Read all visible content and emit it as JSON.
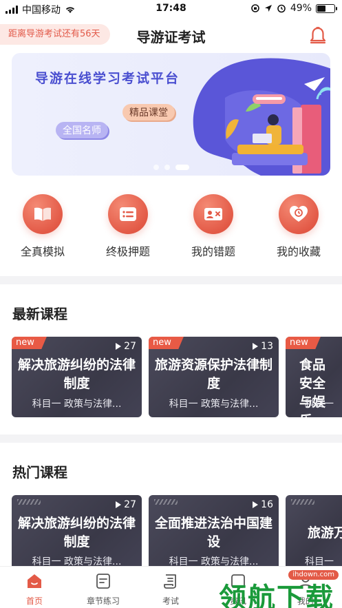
{
  "status_bar": {
    "carrier": "中国移动",
    "time": "17:48",
    "battery": "49%",
    "battery_level": 0.49
  },
  "header": {
    "countdown": "距离导游考试还有56天",
    "title": "导游证考试",
    "bell_icon": "bell-icon"
  },
  "banner": {
    "title": "导游在线学习考试平台",
    "tag_a": "精品课堂",
    "tag_b": "全国名师",
    "active_slide": 3,
    "slides": 3
  },
  "quick_nav": [
    {
      "label": "全真模拟",
      "icon": "book-icon"
    },
    {
      "label": "终极押题",
      "icon": "list-icon"
    },
    {
      "label": "我的错题",
      "icon": "error-card-icon"
    },
    {
      "label": "我的收藏",
      "icon": "heart-clock-icon"
    }
  ],
  "latest": {
    "title": "最新课程",
    "courses": [
      {
        "badge": "new",
        "count": "27",
        "title": "解决旅游纠纷的法律制度",
        "subtitle": "科目一 政策与法律..."
      },
      {
        "badge": "new",
        "count": "13",
        "title": "旅游资源保护法律制度",
        "subtitle": "科目一 政策与法律..."
      },
      {
        "badge": "new",
        "count": "",
        "title": "食品安全与娱乐",
        "subtitle": "科目一"
      }
    ]
  },
  "hot": {
    "title": "热门课程",
    "courses": [
      {
        "count": "27",
        "title": "解决旅游纠纷的法律制度",
        "subtitle": "科目一 政策与法律..."
      },
      {
        "count": "16",
        "title": "全面推进法治中国建设",
        "subtitle": "科目一 政策与法律..."
      },
      {
        "count": "",
        "title": "旅游万",
        "subtitle": "科目一"
      }
    ]
  },
  "tabs": [
    {
      "label": "首页",
      "icon": "home-icon",
      "active": true
    },
    {
      "label": "章节练习",
      "icon": "chapter-icon",
      "active": false
    },
    {
      "label": "考试",
      "icon": "exam-scroll-icon",
      "active": false
    },
    {
      "label": "资讯",
      "icon": "news-icon",
      "active": false
    },
    {
      "label": "我的",
      "icon": "profile-icon",
      "active": false
    }
  ],
  "watermark": {
    "text": "领航下载",
    "badge": "ihdown.com"
  },
  "colors": {
    "accent": "#e35a47",
    "card_bg": "#3f3e4f",
    "banner_purple": "#5a56d8"
  }
}
